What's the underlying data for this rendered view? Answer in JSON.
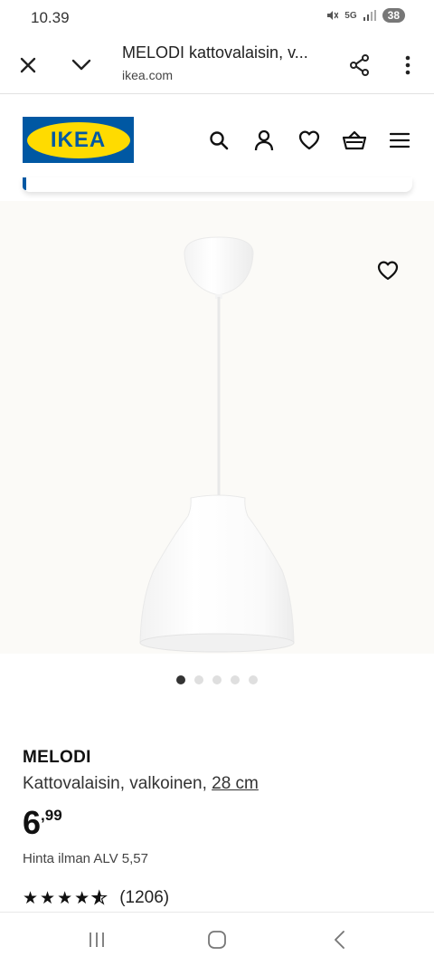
{
  "status": {
    "time": "10.39",
    "network": "5G",
    "battery": "38"
  },
  "browser": {
    "title": "MELODI kattovalaisin, v...",
    "url": "ikea.com"
  },
  "header": {
    "logo": "IKEA",
    "icons": [
      "search-icon",
      "account-icon",
      "heart-icon",
      "basket-icon",
      "menu-icon"
    ]
  },
  "gallery": {
    "image_count": 5,
    "active_index": 0
  },
  "product": {
    "name": "MELODI",
    "description": "Kattovalaisin, valkoinen, ",
    "size": "28 cm",
    "price_int": "6",
    "price_dec": ",99",
    "vat_text": "Hinta ilman ALV 5,57",
    "rating_value": 4.5,
    "rating_count": "(1206)"
  },
  "colors": {
    "ikea_blue": "#0058a3",
    "ikea_yellow": "#ffdb00"
  }
}
